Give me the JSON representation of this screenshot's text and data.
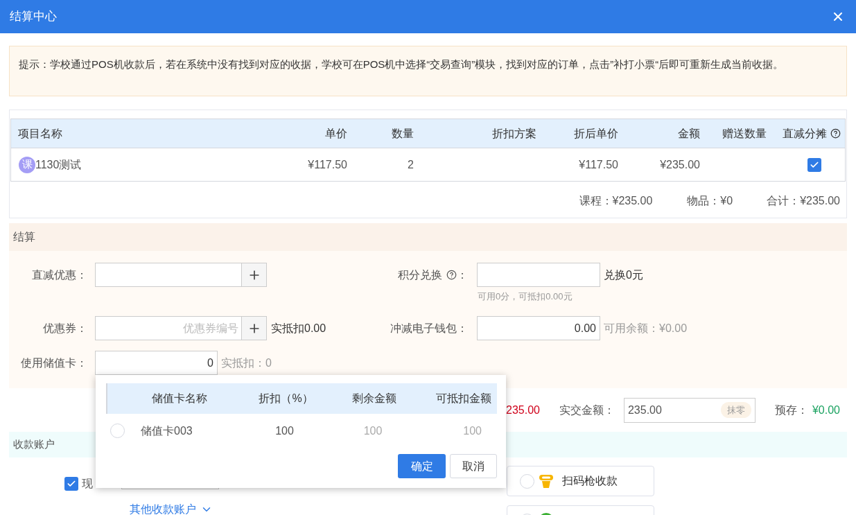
{
  "window": {
    "title": "结算中心"
  },
  "notice": "提示：学校通过POS机收款后，若在系统中没有找到对应的收据，学校可在POS机中选择“交易查询”模块，找到对应的订单，点击”补打小票“后即可重新生成当前收据。",
  "items_table": {
    "columns": [
      "项目名称",
      "单价",
      "数量",
      "折扣方案",
      "折后单价",
      "金额",
      "赠送数量",
      "直减分摊"
    ],
    "rows": [
      {
        "badge": "课",
        "name": "1130测试",
        "unit_price": "¥117.50",
        "quantity": "2",
        "discount_plan": "",
        "discounted_price": "¥117.50",
        "amount": "¥235.00",
        "gift_quantity": "",
        "split_checked": true
      }
    ]
  },
  "summary": [
    "课程：¥235.00",
    "物品：¥0",
    "合计：¥235.00"
  ],
  "settlement": {
    "title": "结算",
    "direct_discount": {
      "label": "直减优惠："
    },
    "points": {
      "label": "积分兑换",
      "colon": "：",
      "result": "兑换0元",
      "hint": "可用0分，可抵扣0.00元"
    },
    "coupon": {
      "label": "优惠券：",
      "placeholder": "优惠券编号",
      "result": "实抵扣0.00"
    },
    "wallet": {
      "label": "冲减电子钱包：",
      "value": "0.00",
      "result": "可用余额：¥0.00"
    },
    "stored_card": {
      "label": "使用储值卡：",
      "value": "0",
      "result": "实抵扣：0"
    }
  },
  "amounts": {
    "receivable": "235.00",
    "paid_label": "实交金额：",
    "paid_value": "235.00",
    "round_off": "抹零",
    "prepaid_label": "预存：",
    "prepaid_value": "¥0.00"
  },
  "payment": {
    "title": "收款账户",
    "cash": {
      "checked": true,
      "label": "现"
    },
    "more_link": "其他收款账户",
    "options": [
      {
        "kind": "scanner",
        "label": "扫码枪收款",
        "selected": false
      },
      {
        "kind": "wechat",
        "selected": false
      }
    ]
  },
  "card_popover": {
    "columns": [
      "储值卡名称",
      "折扣（%）",
      "剩余金额",
      "可抵扣金额"
    ],
    "rows": [
      {
        "selected": false,
        "name": "储值卡003",
        "discount": "100",
        "balance": "100",
        "deductible": "100"
      }
    ],
    "confirm": "确定",
    "cancel": "取消"
  }
}
